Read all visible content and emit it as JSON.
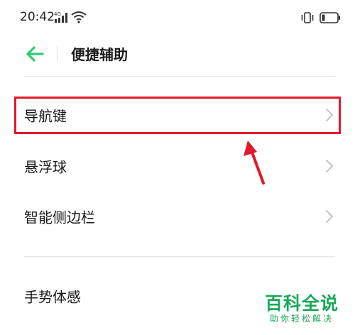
{
  "status_bar": {
    "time": "20:42",
    "signal_icon": "signal-4g-icon",
    "wifi_icon": "wifi-icon",
    "vibrate_icon": "vibrate-icon",
    "battery_icon": "battery-icon",
    "battery_level": 0.2
  },
  "header": {
    "back_icon": "arrow-left-icon",
    "title": "便捷辅助",
    "accent_color": "#2ecc71"
  },
  "menu": {
    "items": [
      {
        "label": "导航键",
        "icon": "chevron-right-icon"
      },
      {
        "label": "悬浮球",
        "icon": "chevron-right-icon"
      },
      {
        "label": "智能侧边栏",
        "icon": "chevron-right-icon"
      },
      {
        "label": "手势体感"
      }
    ]
  },
  "annotation": {
    "highlight_color": "#e3182b"
  },
  "watermark": {
    "main": "百科全说",
    "sub": "助你轻松解决",
    "color": "#1aa85a"
  }
}
